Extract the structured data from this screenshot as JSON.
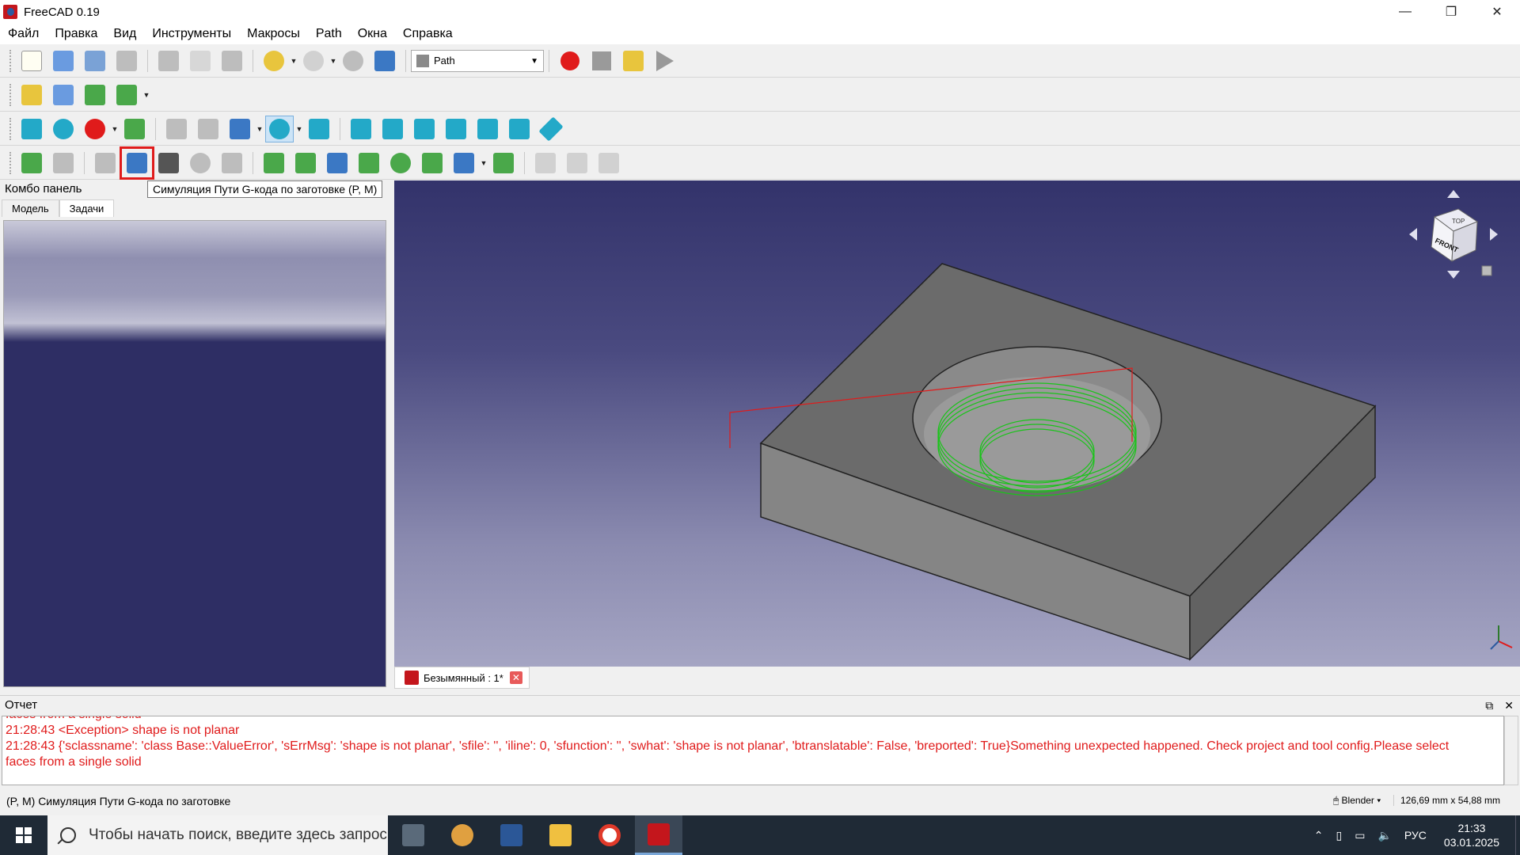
{
  "window": {
    "title": "FreeCAD 0.19"
  },
  "menu": [
    "Файл",
    "Правка",
    "Вид",
    "Инструменты",
    "Макросы",
    "Path",
    "Окна",
    "Справка"
  ],
  "workbench": {
    "selected": "Path"
  },
  "tooltip": "Симуляция Пути G-кода по заготовке (P, M)",
  "combo": {
    "title": "Комбо панель",
    "tabs": [
      "Модель",
      "Задачи"
    ],
    "active_tab": "Задачи"
  },
  "document_tab": {
    "label": "Безымянный : 1*"
  },
  "report": {
    "title": "Отчет",
    "lines": [
      "faces from a single solid",
      "21:28:43  <Exception> shape is not planar",
      "21:28:43  {'sclassname': 'class Base::ValueError', 'sErrMsg': 'shape is not planar', 'sfile': '', 'iline': 0, 'sfunction': '', 'swhat': 'shape is not planar', 'btranslatable': False, 'breported': True}Something unexpected happened. Check project and tool config.Please select",
      "faces from a single solid"
    ],
    "color": "#e01b1b"
  },
  "statusbar": {
    "message": "(P, M) Симуляция Пути G-кода по заготовке",
    "navigation": "Blender",
    "dimensions": "126,69 mm x 54,88 mm"
  },
  "navcube": {
    "top_label": "TOP",
    "front_label": "FRONT"
  },
  "taskbar": {
    "search_placeholder": "Чтобы начать поиск, введите здесь запрос",
    "language": "РУС",
    "time": "21:33",
    "date": "03.01.2025"
  }
}
